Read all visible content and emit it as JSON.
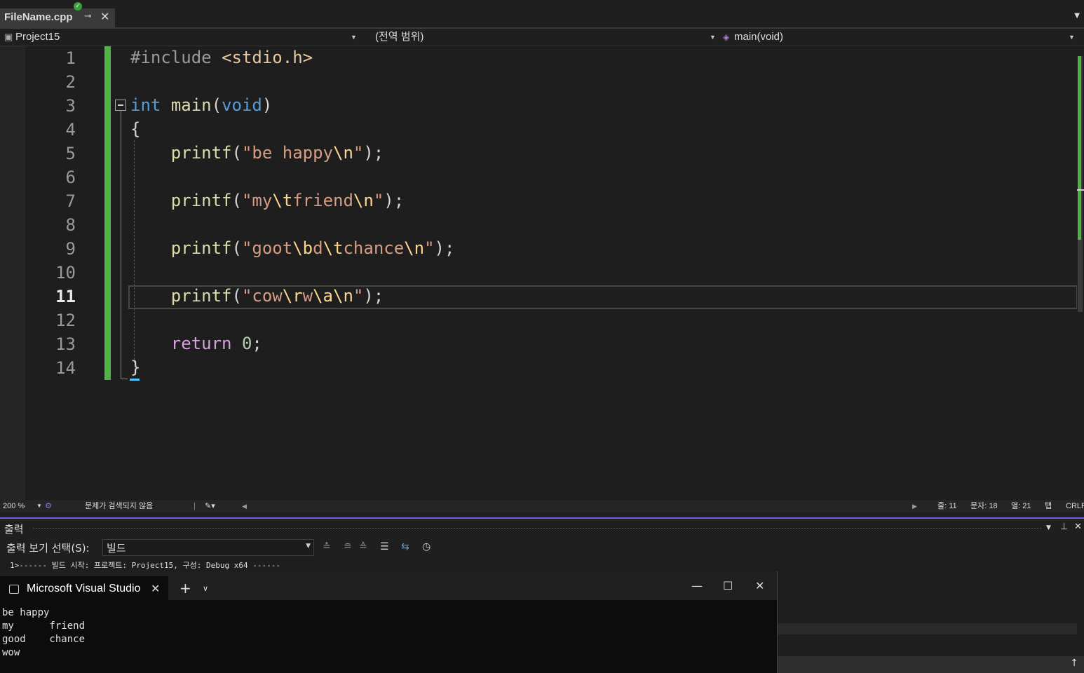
{
  "tab": {
    "filename": "FileName.cpp",
    "pin_glyph": "⊸",
    "close_glyph": "✕"
  },
  "navbar": {
    "project": "Project15",
    "scope": "(전역 범위)",
    "member": "main(void)"
  },
  "editor": {
    "line_numbers": [
      "1",
      "2",
      "3",
      "4",
      "5",
      "6",
      "7",
      "8",
      "9",
      "10",
      "11",
      "12",
      "13",
      "14"
    ],
    "current_line": "11"
  },
  "status": {
    "zoom": "200 %",
    "issues": "문제가 검색되지 않음",
    "line": "줄: 11",
    "char": "문자: 18",
    "col": "열: 21",
    "tabs": "탭",
    "eol": "CRLF"
  },
  "output": {
    "title": "출력",
    "select_label": "출력 보기 선택(S):",
    "select_value": "빌드",
    "log_line": "1>------ 빌드 시작: 프로젝트: Project15, 구성: Debug x64 ------"
  },
  "console": {
    "title": "Microsoft Visual Studio",
    "lines": [
      "be happy",
      "my      friend",
      "good    chance",
      "wow"
    ]
  },
  "colors": {
    "keyword": "#569cd6",
    "function": "#dcdcaa",
    "string": "#d69d85",
    "escape": "#ffd68f",
    "change_bar": "#4fb444",
    "accent": "#7160e8"
  }
}
